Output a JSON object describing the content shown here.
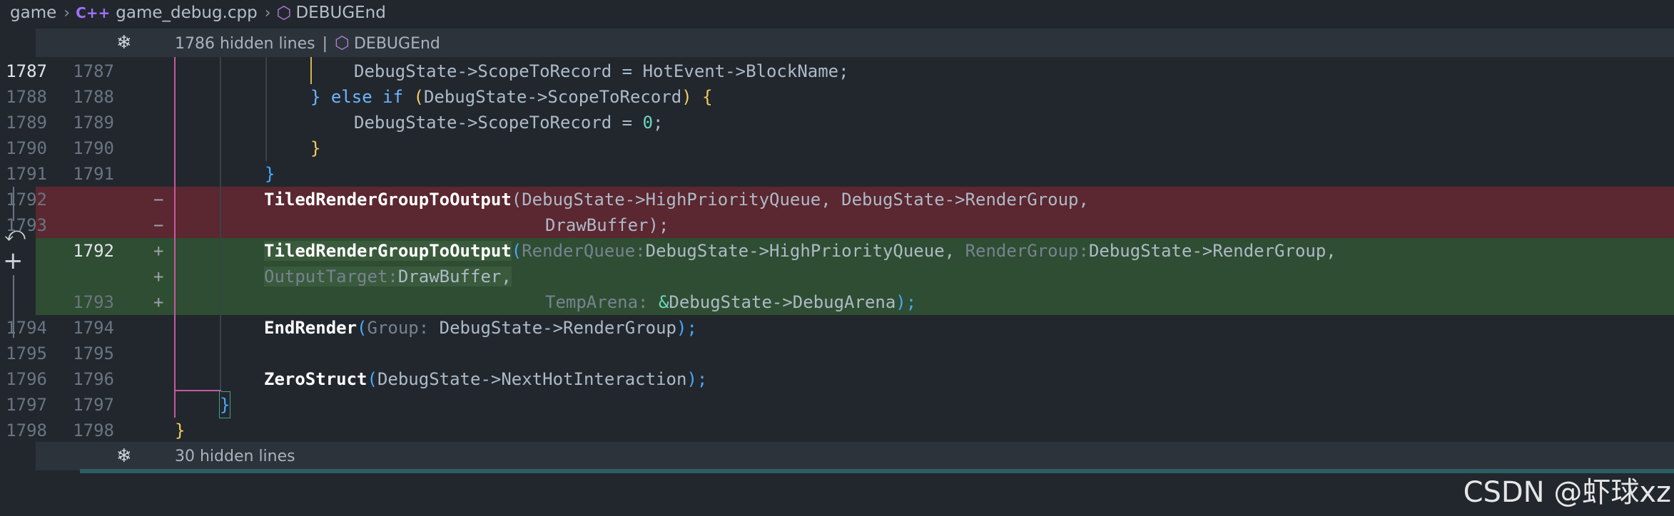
{
  "breadcrumb": {
    "items": [
      "game",
      "game_debug.cpp",
      "DEBUGEnd"
    ],
    "cpp_glyph": "C++"
  },
  "folds": {
    "top": {
      "text": "1786 hidden lines",
      "symbol": "DEBUGEnd"
    },
    "bottom": {
      "text": "30 hidden lines"
    }
  },
  "lines": [
    {
      "old": "1787",
      "new": "1787"
    },
    {
      "old": "1788",
      "new": "1788"
    },
    {
      "old": "1789",
      "new": "1789"
    },
    {
      "old": "1790",
      "new": "1790"
    },
    {
      "old": "1791",
      "new": "1791"
    },
    {
      "old": "1792",
      "new": "",
      "marker": "−"
    },
    {
      "old": "1793",
      "new": "",
      "marker": "−"
    },
    {
      "old": "",
      "new": "1792",
      "marker": "+"
    },
    {
      "old": "",
      "new": "",
      "marker": "+"
    },
    {
      "old": "",
      "new": "1793",
      "marker": "+"
    },
    {
      "old": "1794",
      "new": "1794"
    },
    {
      "old": "1795",
      "new": "1795"
    },
    {
      "old": "1796",
      "new": "1796"
    },
    {
      "old": "1797",
      "new": "1797"
    },
    {
      "old": "1798",
      "new": "1798"
    }
  ],
  "code": {
    "l1": "DebugState->ScopeToRecord = HotEvent->BlockName;",
    "l2_else": "} else if",
    "l2_paren_open": "(",
    "l2_cond": "DebugState->ScopeToRecord",
    "l2_paren_close": ")",
    "l2_brace": "{",
    "l3_a": "DebugState->ScopeToRecord = ",
    "l3_num": "0",
    "l3_b": ";",
    "l4": "}",
    "l5": "}",
    "del1_fn": "TiledRenderGroupToOutput",
    "del1_args": "(DebugState->HighPriorityQueue, DebugState->RenderGroup,",
    "del2": "DrawBuffer);",
    "add1_fn": "TiledRenderGroupToOutput",
    "add1_paren": "(",
    "add1_hint1": "RenderQueue:",
    "add1_arg1": "DebugState->HighPriorityQueue,",
    "add1_hint2": "RenderGroup:",
    "add1_arg2": "DebugState->RenderGroup,",
    "add2_hint": "OutputTarget:",
    "add2_arg": "DrawBuffer,",
    "add3_hint": "TempArena:",
    "add3_amp": "&",
    "add3_arg": "DebugState->DebugArena",
    "add3_close": ");",
    "end_fn": "EndRender",
    "end_paren": "(",
    "end_hint": "Group:",
    "end_arg": "DebugState->RenderGroup",
    "end_close": ");",
    "zero_fn": "ZeroStruct",
    "zero_paren": "(",
    "zero_arg": "DebugState->NextHotInteraction",
    "zero_close": ");",
    "close_inner": "}",
    "close_outer": "}"
  },
  "watermark": "CSDN @虾球xz",
  "colors": {
    "deleted_bg": "#5b2730",
    "added_bg": "#2f4d32",
    "keyword": "#6cb6ff",
    "number": "#6bd6c0",
    "bracket_yellow": "#f2cc60",
    "bracket_blue": "#4aa8ff"
  }
}
